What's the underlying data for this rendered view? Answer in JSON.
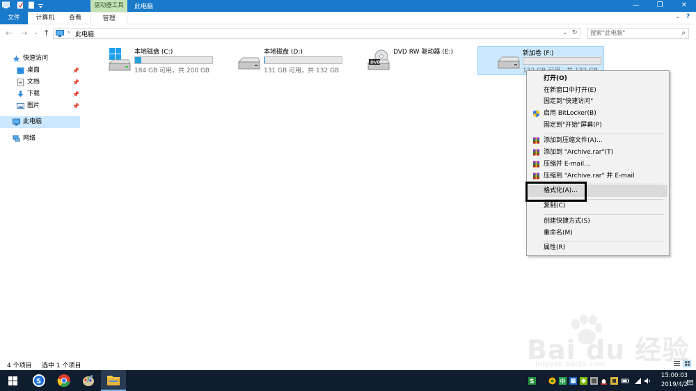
{
  "titlebar": {
    "tool_tab": "驱动器工具",
    "title": "此电脑",
    "quick_access_icons": [
      "pc-icon",
      "properties-icon",
      "new-folder-icon",
      "dropdown-icon"
    ],
    "minimize": "—",
    "maximize": "❐",
    "close": "✕"
  },
  "ribbon": {
    "tabs": [
      "文件",
      "计算机",
      "查看",
      "管理"
    ],
    "collapse": "⌄",
    "help": "?"
  },
  "address": {
    "back": "←",
    "forward": "→",
    "recent": "⌄",
    "up": "↑",
    "separator": "›",
    "path": "此电脑",
    "dropdown": "⌄",
    "refresh": "↻",
    "search_placeholder": "搜索\"此电脑\"",
    "search_icon": "⌕"
  },
  "nav": {
    "quick_access": "快速访问",
    "items": [
      {
        "label": "桌面",
        "icon": "desktop-icon",
        "pinned": true
      },
      {
        "label": "文档",
        "icon": "documents-icon",
        "pinned": true
      },
      {
        "label": "下载",
        "icon": "downloads-icon",
        "pinned": true
      },
      {
        "label": "图片",
        "icon": "pictures-icon",
        "pinned": true
      }
    ],
    "pin_glyph": "📌",
    "this_pc": "此电脑",
    "network": "网络"
  },
  "drives": [
    {
      "name": "本地磁盘 (C:)",
      "size": "184 GB 可用，共 200 GB",
      "used_fraction": 0.08,
      "icon": "windows-drive-icon"
    },
    {
      "name": "本地磁盘 (D:)",
      "size": "131 GB 可用，共 132 GB",
      "used_fraction": 0.01,
      "icon": "hard-drive-icon"
    },
    {
      "name": "DVD RW 驱动器 (E:)",
      "size": "",
      "icon": "dvd-drive-icon"
    },
    {
      "name": "新加卷 (F:)",
      "size": "132 GB 可用，共 132 GB",
      "used_fraction": 0.0,
      "icon": "hard-drive-icon",
      "selected": true
    }
  ],
  "context_menu": {
    "open": "打开(O)",
    "open_new_window": "在新窗口中打开(E)",
    "pin_quick_access": "固定到\"快速访问\"",
    "bitlocker": "启用 BitLocker(B)",
    "pin_start": "固定到\"开始\"屏幕(P)",
    "add_archive": "添加到压缩文件(A)...",
    "add_archive_rar": "添加到 \"Archive.rar\"(T)",
    "compress_email": "压缩并 E-mail...",
    "compress_rar_email": "压缩到 \"Archive.rar\" 并 E-mail",
    "format": "格式化(A)...",
    "copy": "复制(C)",
    "create_shortcut": "创建快捷方式(S)",
    "rename": "重命名(M)",
    "properties": "属性(R)"
  },
  "status": {
    "item_count": "4 个项目",
    "selected": "选中 1 个项目"
  },
  "taskbar": {
    "time": "15:00:03",
    "date": "2019/4/2"
  },
  "watermark": {
    "text": "Bai du 经验",
    "url": "jingyan.baidu.com"
  },
  "colors": {
    "accent": "#1979ca",
    "selection": "#cce8ff",
    "drive_fill": "#26a0da",
    "tool_tab": "#c5e2b8",
    "taskbar": "#0f1d2e"
  }
}
